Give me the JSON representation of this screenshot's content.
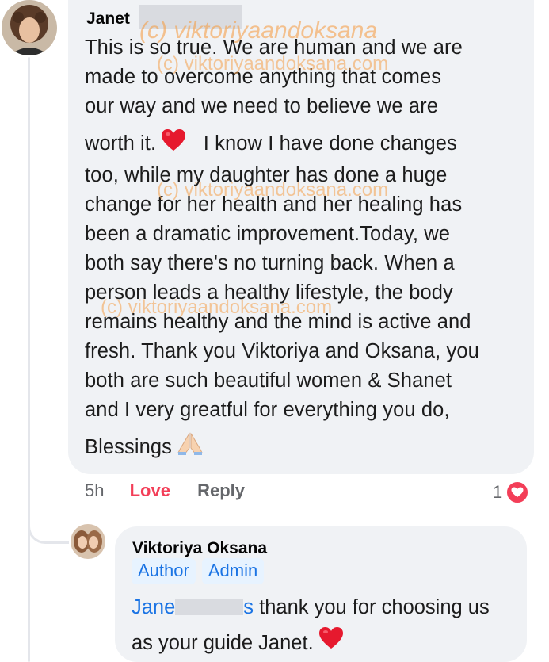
{
  "comment": {
    "author": "Janet",
    "body_lines": [
      "This is so true. We are human and we are",
      "made to overcome anything that comes",
      "our way and we need to believe we are",
      "worth it.",
      "I know I have done changes",
      "too, while my daughter has done a huge",
      "change for her health and her healing has",
      "been a dramatic improvement.Today, we",
      "both say there's no turning back. When a",
      "person leads a healthy lifestyle, the body",
      "remains healthy and the mind is active and",
      "fresh. Thank you Viktoriya and Oksana, you",
      "both are such beautiful women & Shanet",
      "and I very greatful for everything you do,",
      "Blessings"
    ],
    "time": "5h",
    "love_label": "Love",
    "reply_label": "Reply",
    "reaction_count": "1",
    "reaction_icon": "heart-icon"
  },
  "watermark": {
    "text_large": "(c) viktoriyaandoksana",
    "text_small": "(c) viktoriyaandoksana.com"
  },
  "reply": {
    "author": "Viktoriya Oksana",
    "badges": [
      "Author",
      "Admin"
    ],
    "mention_start": "Jane",
    "mention_end": "s",
    "text_line1": " thank you for choosing us",
    "text_line2": "as your guide Janet."
  },
  "colors": {
    "bubble": "#f0f2f5",
    "love": "#f33e58",
    "link": "#1b74e4",
    "badge_bg": "#e7f3ff",
    "meta": "#65676b",
    "watermark": "#f5a04a"
  }
}
